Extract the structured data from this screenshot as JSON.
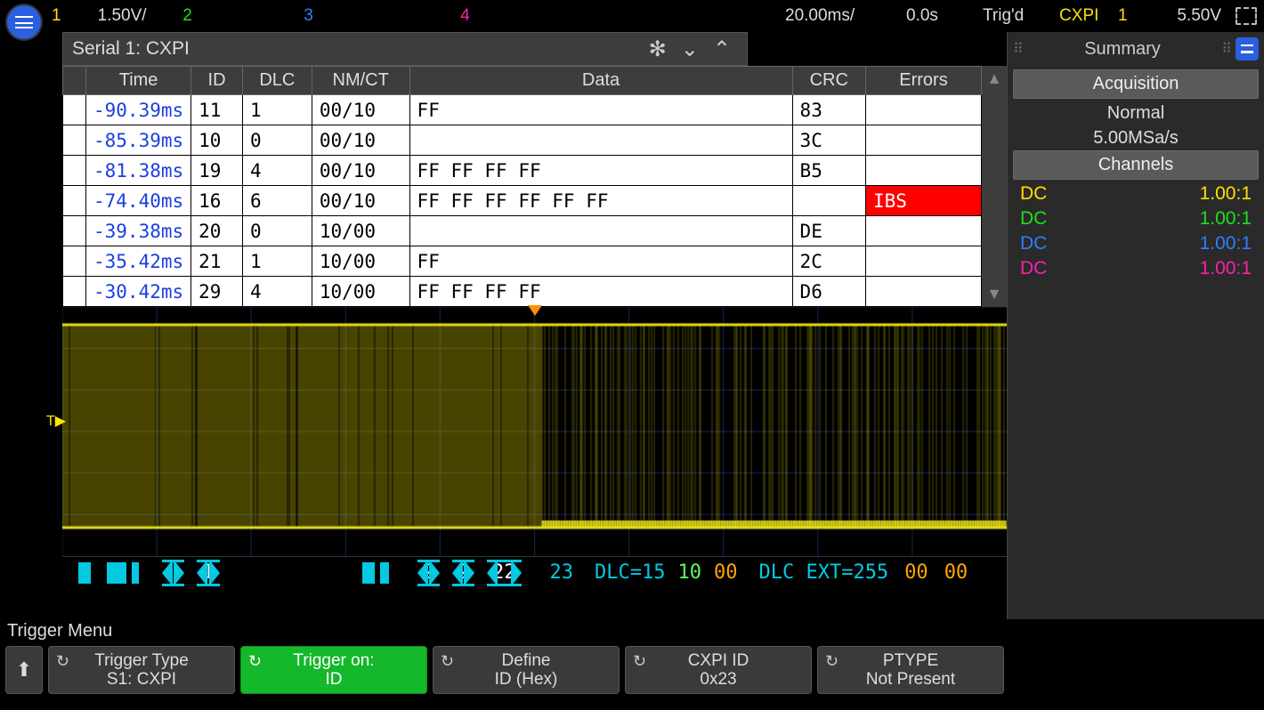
{
  "topbar": {
    "ch1_num": "1",
    "ch1_scale": "1.50V/",
    "ch2_num": "2",
    "ch3_num": "3",
    "ch4_num": "4",
    "timebase": "20.00ms/",
    "delay": "0.0s",
    "status": "Trig'd",
    "trig_src": "CXPI",
    "trig_ch": "1",
    "trig_level": "5.50V"
  },
  "panel": {
    "title": "Serial 1: CXPI"
  },
  "table": {
    "headers": {
      "time": "Time",
      "id": "ID",
      "dlc": "DLC",
      "nmct": "NM/CT",
      "data": "Data",
      "crc": "CRC",
      "errors": "Errors"
    },
    "rows": [
      {
        "time": "-90.39ms",
        "id": "11",
        "dlc": "1",
        "nmct": "00/10",
        "data": "FF",
        "crc": "83",
        "err": ""
      },
      {
        "time": "-85.39ms",
        "id": "10",
        "dlc": "0",
        "nmct": "00/10",
        "data": "",
        "crc": "3C",
        "err": ""
      },
      {
        "time": "-81.38ms",
        "id": "19",
        "dlc": "4",
        "nmct": "00/10",
        "data": "FF FF FF FF",
        "crc": "B5",
        "err": ""
      },
      {
        "time": "-74.40ms",
        "id": "16",
        "dlc": "6",
        "nmct": "00/10",
        "data": "FF FF FF FF FF FF",
        "crc": "",
        "err": "IBS"
      },
      {
        "time": "-39.38ms",
        "id": "20",
        "dlc": "0",
        "nmct": "10/00",
        "data": "",
        "crc": "DE",
        "err": ""
      },
      {
        "time": "-35.42ms",
        "id": "21",
        "dlc": "1",
        "nmct": "10/00",
        "data": "FF",
        "crc": "2C",
        "err": ""
      },
      {
        "time": "-30.42ms",
        "id": "29",
        "dlc": "4",
        "nmct": "10/00",
        "data": "FF FF FF FF",
        "crc": "D6",
        "err": ""
      }
    ]
  },
  "decode": {
    "id": "23",
    "dlc_label": "DLC=15",
    "dlc_v1": "10",
    "dlc_v2": "00",
    "ext": "DLC EXT=255",
    "b1": "00",
    "b2": "00",
    "h1": "1",
    "h2a": "2",
    "h2b": "2",
    "h22": "22"
  },
  "sidebar": {
    "title": "Summary",
    "acq_btn": "Acquisition",
    "acq_mode": "Normal",
    "acq_rate": "5.00MSa/s",
    "ch_btn": "Channels",
    "channels": [
      {
        "label": "DC",
        "ratio": "1.00:1",
        "color": "#ffe000"
      },
      {
        "label": "DC",
        "ratio": "1.00:1",
        "color": "#1de01d"
      },
      {
        "label": "DC",
        "ratio": "1.00:1",
        "color": "#2f7fff"
      },
      {
        "label": "DC",
        "ratio": "1.00:1",
        "color": "#ff1fb0"
      }
    ]
  },
  "footer": {
    "title": "Trigger Menu",
    "btns": [
      {
        "label": "Trigger Type",
        "value": "S1: CXPI",
        "active": false
      },
      {
        "label": "Trigger on:",
        "value": "ID",
        "active": true
      },
      {
        "label": "Define",
        "value": "ID (Hex)",
        "active": false
      },
      {
        "label": "CXPI ID",
        "value": "0x23",
        "active": false
      },
      {
        "label": "PTYPE",
        "value": "Not Present",
        "active": false
      }
    ]
  }
}
